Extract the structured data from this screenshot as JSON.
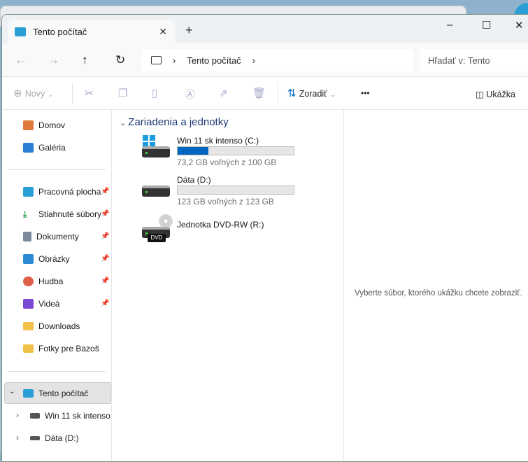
{
  "window": {
    "tab_title": "Tento počítač",
    "new_tab": "+",
    "minimize": "–",
    "maximize": "☐",
    "close": "✕"
  },
  "address": {
    "crumb": "Tento počítač",
    "search_placeholder": "Hľadať v: Tento"
  },
  "toolbar": {
    "new_label": "Nový",
    "sort_label": "Zoradiť",
    "more": "•••",
    "preview_label": "Ukážka"
  },
  "sidebar": {
    "items": [
      {
        "label": "Domov",
        "icon": "home",
        "color": "#e07a3a"
      },
      {
        "label": "Galéria",
        "icon": "gallery",
        "color": "#2b7fd4"
      },
      {
        "label": "Pracovná plocha",
        "icon": "desktop",
        "color": "#2a9fd6",
        "pinned": true
      },
      {
        "label": "Stiahnuté súbory",
        "icon": "download",
        "color": "#1f9a4c",
        "pinned": true
      },
      {
        "label": "Dokumenty",
        "icon": "documents",
        "color": "#7a8a9a",
        "pinned": true
      },
      {
        "label": "Obrázky",
        "icon": "pictures",
        "color": "#2b8ad4",
        "pinned": true
      },
      {
        "label": "Hudba",
        "icon": "music",
        "color": "#e0604a",
        "pinned": true
      },
      {
        "label": "Videá",
        "icon": "videos",
        "color": "#7a4ad4",
        "pinned": true
      },
      {
        "label": "Downloads",
        "icon": "folder",
        "color": "#f2c14a"
      },
      {
        "label": "Fotky pre Bazoš",
        "icon": "folder",
        "color": "#f2c14a"
      }
    ],
    "tree": [
      {
        "label": "Tento počítač"
      },
      {
        "label": "Win 11 sk intenso"
      },
      {
        "label": "Dáta (D:)"
      }
    ]
  },
  "content": {
    "group": "Zariadenia a jednotky",
    "drives": [
      {
        "name": "Win 11 sk intenso (C:)",
        "free": "73,2 GB voľných z 100 GB",
        "used_fraction": 0.268
      },
      {
        "name": "Dáta (D:)",
        "free": "123 GB voľných z 123 GB",
        "used_fraction": 0.0
      },
      {
        "name": "Jednotka DVD-RW (R:)",
        "badge": "DVD"
      }
    ]
  },
  "preview": {
    "message": "Vyberte súbor, ktorého ukážku chcete zobraziť."
  }
}
